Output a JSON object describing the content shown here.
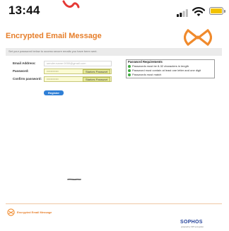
{
  "status_bar": {
    "time": "13:44"
  },
  "header": {
    "title": "Encrypted Email Message",
    "instruction": "Set your password below to access secure emails you have been sent."
  },
  "form": {
    "email_label": "Email Address:",
    "email_value": "sender.name.0000@gmail.com",
    "password_label": "Password:",
    "password_value": "••••••••••••",
    "password_badge": "Starkes Passwort",
    "confirm_label": "Confirm password:",
    "confirm_value": "••••••••••••",
    "confirm_badge": "Starkes Passwort",
    "register_label": "Register"
  },
  "requirements": {
    "title": "Password Requirements",
    "items": [
      "Passwords must be 8-32 characters in length",
      "Password must contain at least one letter and one digit",
      "Passwords must match"
    ]
  },
  "footer": {
    "label": "Encrypted Email Message",
    "brand": "SOPHOS",
    "brand_sub": "powered by SPX encryption"
  },
  "colors": {
    "accent": "#e67e2a",
    "register": "#2f7fd6",
    "battery": "#f2c200",
    "brand": "#24429a"
  }
}
